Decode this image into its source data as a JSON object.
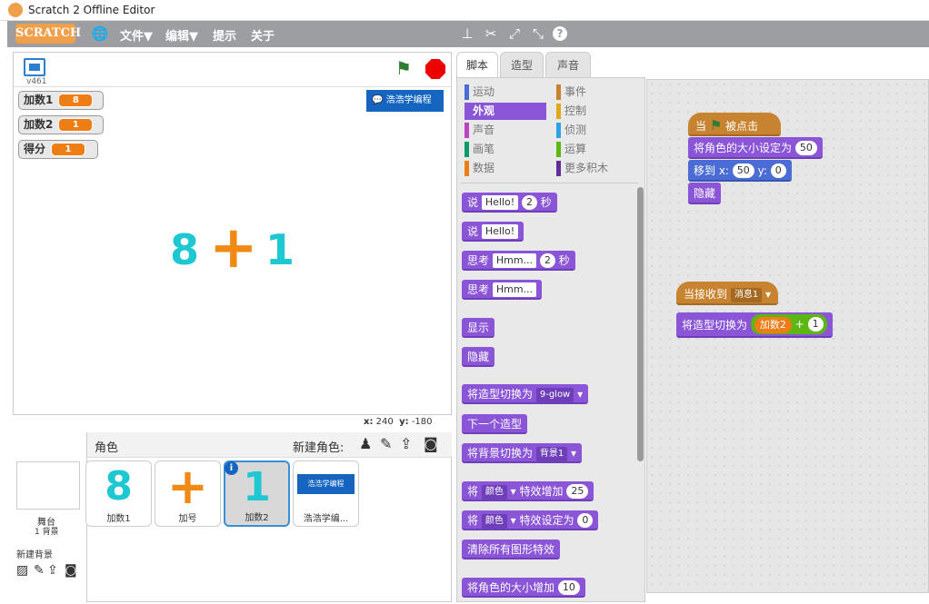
{
  "window": {
    "title": "Scratch 2 Offline Editor"
  },
  "menu": {
    "logo": "SCRATCH",
    "file": "文件▼",
    "edit": "编辑▼",
    "tips": "提示",
    "about": "关于"
  },
  "stage": {
    "version": "v461",
    "variables": [
      {
        "name": "加数1",
        "value": "8"
      },
      {
        "name": "加数2",
        "value": "1"
      },
      {
        "name": "得分",
        "value": "1"
      }
    ],
    "badge": "浩浩学编程",
    "display": {
      "left": "8",
      "op": "+",
      "right": "1"
    },
    "coords": {
      "x_label": "x:",
      "x": "240",
      "y_label": "y:",
      "y": "-180"
    }
  },
  "sprites": {
    "header": "角色",
    "new_sprite": "新建角色:",
    "stage": {
      "name": "舞台",
      "backdrops": "1 背景"
    },
    "new_backdrop": "新建背景",
    "items": [
      {
        "name": "加数1",
        "glyph": "8"
      },
      {
        "name": "加号",
        "glyph": "+"
      },
      {
        "name": "加数2",
        "glyph": "1"
      },
      {
        "name": "浩浩学编...",
        "glyph": "浩浩学编程"
      }
    ]
  },
  "tabs": [
    "脚本",
    "造型",
    "声音"
  ],
  "categories": {
    "left": [
      "运动",
      "外观",
      "声音",
      "画笔",
      "数据"
    ],
    "right": [
      "事件",
      "控制",
      "侦测",
      "运算",
      "更多积木"
    ],
    "colors": {
      "left": [
        "#4a6cd4",
        "#8a55d7",
        "#bb42c3",
        "#0e9a6c",
        "#ee7d16"
      ],
      "right": [
        "#c88330",
        "#e1a91a",
        "#2ca5e2",
        "#5cb712",
        "#632d99"
      ]
    }
  },
  "palette": {
    "say_secs": {
      "a": "说",
      "b": "Hello!",
      "c": "2",
      "d": "秒"
    },
    "say": {
      "a": "说",
      "b": "Hello!"
    },
    "think_secs": {
      "a": "思考",
      "b": "Hmm...",
      "c": "2",
      "d": "秒"
    },
    "think": {
      "a": "思考",
      "b": "Hmm..."
    },
    "show": "显示",
    "hide": "隐藏",
    "switch_costume": {
      "a": "将造型切换为",
      "b": "9-glow"
    },
    "next_costume": "下一个造型",
    "switch_backdrop": {
      "a": "将背景切换为",
      "b": "背景1"
    },
    "change_effect": {
      "a": "将",
      "b": "颜色",
      "c": "特效增加",
      "d": "25"
    },
    "set_effect": {
      "a": "将",
      "b": "颜色",
      "c": "特效设定为",
      "d": "0"
    },
    "clear_effects": "清除所有图形特效",
    "change_size": {
      "a": "将角色的大小增加",
      "b": "10"
    }
  },
  "scripts": {
    "s1": {
      "hat_a": "当",
      "hat_b": "被点击",
      "set_size": "将角色的大小设定为",
      "size": "50",
      "goto_a": "移到 x:",
      "goto_x": "50",
      "goto_b": "y:",
      "goto_y": "0",
      "hide": "隐藏"
    },
    "s2": {
      "hat_a": "当接收到",
      "msg": "消息1",
      "switch": "将造型切换为",
      "var": "加数2",
      "plus": "+",
      "num": "1"
    }
  }
}
